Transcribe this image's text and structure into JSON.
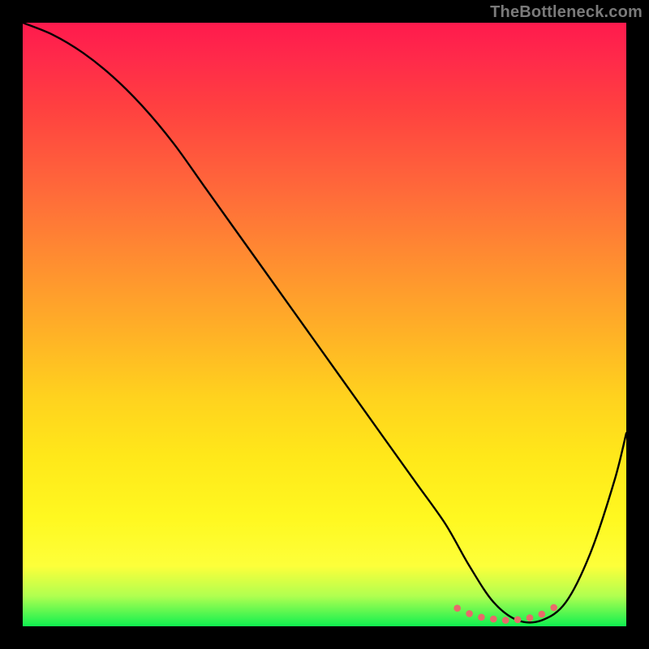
{
  "watermark": "TheBottleneck.com",
  "colors": {
    "frame": "#000000",
    "curve": "#000000",
    "marker": "#e86a6a",
    "gradient_top": "#ff1a4d",
    "gradient_bottom": "#10f050",
    "watermark": "#7a7a7a"
  },
  "chart_data": {
    "type": "line",
    "title": "",
    "xlabel": "",
    "ylabel": "",
    "xlim": [
      0,
      100
    ],
    "ylim": [
      0,
      100
    ],
    "grid": false,
    "series": [
      {
        "name": "bottleneck-curve",
        "x": [
          0,
          5,
          10,
          15,
          20,
          25,
          30,
          35,
          40,
          45,
          50,
          55,
          60,
          65,
          70,
          74,
          78,
          82,
          86,
          90,
          94,
          98,
          100
        ],
        "values": [
          100,
          98,
          95,
          91,
          86,
          80,
          73,
          66,
          59,
          52,
          45,
          38,
          31,
          24,
          17,
          10,
          4,
          1,
          1,
          4,
          12,
          24,
          32
        ]
      }
    ],
    "trough_markers": {
      "name": "optimal-range",
      "x": [
        72,
        74,
        76,
        78,
        80,
        82,
        84,
        86,
        88
      ],
      "values": [
        3,
        2.1,
        1.5,
        1.2,
        1.0,
        1.1,
        1.4,
        2.0,
        3.1
      ]
    }
  }
}
